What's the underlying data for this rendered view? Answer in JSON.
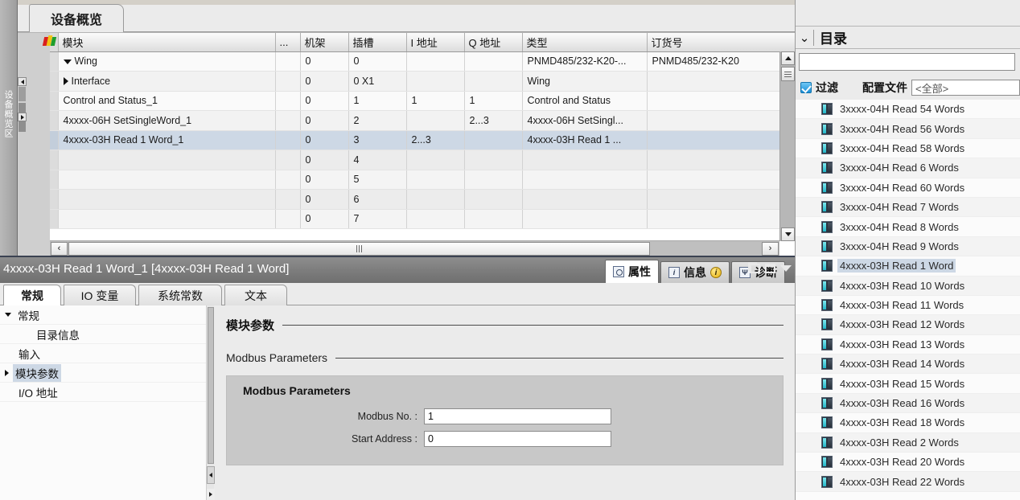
{
  "editor": {
    "vertical_strip_label": "设备概览区",
    "tab_label": "设备概览",
    "table": {
      "columns": [
        "",
        "",
        "模块",
        "...",
        "机架",
        "插槽",
        "I 地址",
        "Q 地址",
        "类型",
        "订货号"
      ],
      "rows": [
        {
          "indent": 1,
          "twisty": "down",
          "module": "Wing",
          "dots": "",
          "rack": "0",
          "slot": "0",
          "i_addr": "",
          "q_addr": "",
          "type": "PNMD485/232-K20-...",
          "order_no": "PNMD485/232-K20"
        },
        {
          "indent": 2,
          "twisty": "right",
          "module": "Interface",
          "dots": "",
          "rack": "0",
          "slot": "0 X1",
          "i_addr": "",
          "q_addr": "",
          "type": "Wing",
          "order_no": ""
        },
        {
          "indent": 2,
          "twisty": "none",
          "module": "Control and Status_1",
          "dots": "",
          "rack": "0",
          "slot": "1",
          "i_addr": "1",
          "q_addr": "1",
          "type": "Control and Status",
          "order_no": ""
        },
        {
          "indent": 2,
          "twisty": "none",
          "module": "4xxxx-06H SetSingleWord_1",
          "dots": "",
          "rack": "0",
          "slot": "2",
          "i_addr": "",
          "q_addr": "2...3",
          "type": "4xxxx-06H SetSingl...",
          "order_no": ""
        },
        {
          "indent": 2,
          "twisty": "none",
          "module": "4xxxx-03H Read 1 Word_1",
          "dots": "",
          "rack": "0",
          "slot": "3",
          "i_addr": "2...3",
          "q_addr": "",
          "type": "4xxxx-03H Read 1 ...",
          "order_no": "",
          "selected": true
        },
        {
          "indent": 0,
          "twisty": "none",
          "module": "",
          "dots": "",
          "rack": "0",
          "slot": "4",
          "i_addr": "",
          "q_addr": "",
          "type": "",
          "order_no": "",
          "empty": true
        },
        {
          "indent": 0,
          "twisty": "none",
          "module": "",
          "dots": "",
          "rack": "0",
          "slot": "5",
          "i_addr": "",
          "q_addr": "",
          "type": "",
          "order_no": "",
          "empty": true
        },
        {
          "indent": 0,
          "twisty": "none",
          "module": "",
          "dots": "",
          "rack": "0",
          "slot": "6",
          "i_addr": "",
          "q_addr": "",
          "type": "",
          "order_no": "",
          "empty": true
        },
        {
          "indent": 0,
          "twisty": "none",
          "module": "",
          "dots": "",
          "rack": "0",
          "slot": "7",
          "i_addr": "",
          "q_addr": "",
          "type": "",
          "order_no": "",
          "empty": true
        }
      ]
    },
    "scroll_left_label": "‹",
    "scroll_right_label": "›"
  },
  "properties": {
    "title": "4xxxx-03H Read 1 Word_1  [4xxxx-03H Read 1 Word]",
    "tabs": [
      {
        "label": "属性",
        "icon": "properties-icon",
        "active": true
      },
      {
        "label": "信息",
        "icon": "info-icon",
        "badge": "i",
        "active": false
      },
      {
        "label": "诊断",
        "icon": "diagnostics-icon",
        "active": false
      }
    ],
    "subtabs": [
      {
        "label": "常规",
        "active": true
      },
      {
        "label": "IO 变量",
        "active": false
      },
      {
        "label": "系统常数",
        "active": false
      },
      {
        "label": "文本",
        "active": false
      }
    ],
    "nav": [
      {
        "label": "常规",
        "twisty": "down",
        "indent": 0,
        "selected": false
      },
      {
        "label": "目录信息",
        "twisty": "none",
        "indent": 1,
        "selected": false
      },
      {
        "label": "输入",
        "twisty": "none",
        "indent": 0,
        "selected": false
      },
      {
        "label": "模块参数",
        "twisty": "right",
        "indent": 0,
        "selected": true
      },
      {
        "label": "I/O 地址",
        "twisty": "none",
        "indent": 0,
        "selected": false
      }
    ],
    "section_title": "模块参数",
    "subsection_title": "Modbus Parameters",
    "group_title": "Modbus Parameters",
    "fields": [
      {
        "label": "Modbus No. :",
        "value": "1"
      },
      {
        "label": "Start Address :",
        "value": "0"
      }
    ]
  },
  "catalog": {
    "header_title": "目录",
    "chevron": "⌄",
    "search_value": "",
    "search_placeholder": "",
    "filter_label": "过滤",
    "profile_label": "配置文件",
    "profile_value": "<全部>",
    "items": [
      {
        "label": "3xxxx-04H Read 54 Words",
        "selected": false
      },
      {
        "label": "3xxxx-04H Read 56 Words",
        "selected": false
      },
      {
        "label": "3xxxx-04H Read 58 Words",
        "selected": false
      },
      {
        "label": "3xxxx-04H Read 6 Words",
        "selected": false
      },
      {
        "label": "3xxxx-04H Read 60 Words",
        "selected": false
      },
      {
        "label": "3xxxx-04H Read 7 Words",
        "selected": false
      },
      {
        "label": "3xxxx-04H Read 8 Words",
        "selected": false
      },
      {
        "label": "3xxxx-04H Read 9 Words",
        "selected": false
      },
      {
        "label": "4xxxx-03H Read 1 Word",
        "selected": true
      },
      {
        "label": "4xxxx-03H Read 10 Words",
        "selected": false
      },
      {
        "label": "4xxxx-03H Read 11 Words",
        "selected": false
      },
      {
        "label": "4xxxx-03H Read 12 Words",
        "selected": false
      },
      {
        "label": "4xxxx-03H Read 13 Words",
        "selected": false
      },
      {
        "label": "4xxxx-03H Read 14 Words",
        "selected": false
      },
      {
        "label": "4xxxx-03H Read 15 Words",
        "selected": false
      },
      {
        "label": "4xxxx-03H Read 16 Words",
        "selected": false
      },
      {
        "label": "4xxxx-03H Read 18 Words",
        "selected": false
      },
      {
        "label": "4xxxx-03H Read 2 Words",
        "selected": false
      },
      {
        "label": "4xxxx-03H Read 20 Words",
        "selected": false
      },
      {
        "label": "4xxxx-03H Read 22 Words",
        "selected": false
      }
    ]
  }
}
